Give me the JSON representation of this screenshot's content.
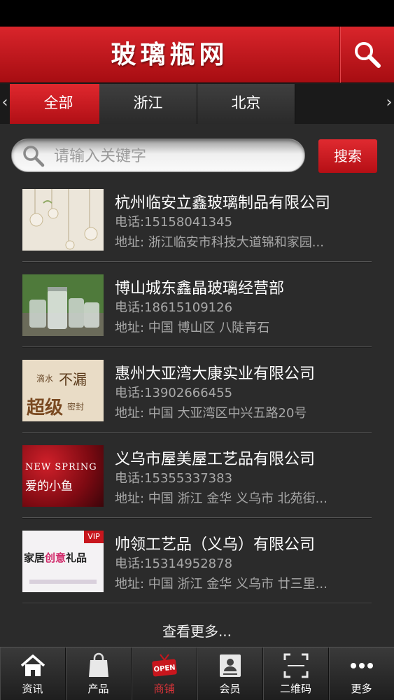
{
  "header": {
    "title": "玻璃瓶网"
  },
  "tabs": {
    "prev_arrow": "‹",
    "next_arrow": "›",
    "items": [
      {
        "label": "全部",
        "active": true
      },
      {
        "label": "浙江",
        "active": false
      },
      {
        "label": "北京",
        "active": false
      }
    ]
  },
  "search": {
    "placeholder": "请输入关键字",
    "value": "",
    "button_label": "搜索"
  },
  "listings": [
    {
      "name": "杭州临安立鑫玻璃制品有限公司",
      "phone": "电话:15158041345",
      "address": "地址: 浙江临安市科技大道锦和家园..."
    },
    {
      "name": "博山城东鑫晶玻璃经营部",
      "phone": "电话:18615109126",
      "address": "地址: 中国 博山区 八陡青石"
    },
    {
      "name": "惠州大亚湾大康实业有限公司",
      "phone": "电话:13902666455",
      "address": "地址: 中国 大亚湾区中兴五路20号",
      "thumb_text": {
        "line1": "滴水",
        "line2": "不漏",
        "line3": "超级",
        "line4": "密封"
      }
    },
    {
      "name": "义乌市屋美屋工艺品有限公司",
      "phone": "电话:15355337383",
      "address": "地址: 中国 浙江 金华 义乌市 北苑街...",
      "thumb_text": {
        "line1": "NEW SPRING",
        "line2": "爱的小鱼"
      }
    },
    {
      "name": "帅领工艺品（义乌）有限公司",
      "phone": "电话:15314952878",
      "address": "地址: 中国 浙江 金华 义乌市 廿三里...",
      "thumb_text": {
        "badge": "VIP",
        "main_a": "家居",
        "main_b": "创意",
        "main_c": "礼品"
      }
    }
  ],
  "more_label": "查看更多...",
  "bottom_nav": [
    {
      "label": "资讯",
      "icon": "home-icon",
      "active": false
    },
    {
      "label": "产品",
      "icon": "shopping-bag-icon",
      "active": false
    },
    {
      "label": "商铺",
      "icon": "open-sign-icon",
      "active": true,
      "sign_text": "OPEN"
    },
    {
      "label": "会员",
      "icon": "member-card-icon",
      "active": false
    },
    {
      "label": "二维码",
      "icon": "qr-scan-icon",
      "active": false
    },
    {
      "label": "更多",
      "icon": "more-dots-icon",
      "active": false
    }
  ],
  "colors": {
    "brand_red": "#c8161d",
    "background": "#2b2b2b",
    "active_nav": "#e2343a"
  }
}
